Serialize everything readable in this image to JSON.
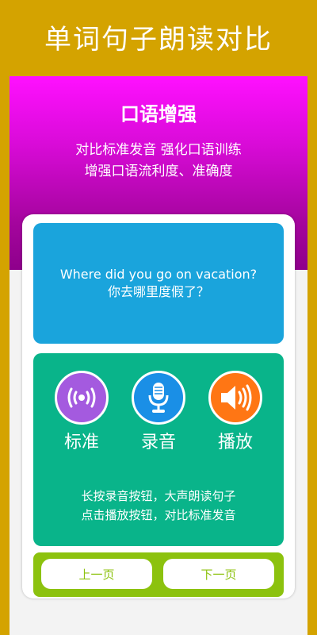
{
  "page": {
    "heading": "单词句子朗读对比"
  },
  "banner": {
    "title": "口语增强",
    "subtitle_line1": "对比标准发音 强化口语训练",
    "subtitle_line2": "增强口语流利度、准确度"
  },
  "sentence": {
    "english": "Where did you go on vacation?",
    "chinese": "你去哪里度假了？"
  },
  "controls": [
    {
      "label": "标准",
      "icon": "broadcast-icon"
    },
    {
      "label": "录音",
      "icon": "microphone-icon"
    },
    {
      "label": "播放",
      "icon": "speaker-icon"
    }
  ],
  "hint": {
    "line1": "长按录音按钮，大声朗读句子",
    "line2": "点击播放按钮，对比标准发音"
  },
  "navigation": {
    "prev_label": "上一页",
    "next_label": "下一页"
  },
  "colors": {
    "background": "#d4a300",
    "banner_top": "#ff10ff",
    "banner_bottom": "#8e008b",
    "sentence_box": "#1aa4dc",
    "control_box": "#09b48a",
    "nav_bar": "#8cc20e"
  }
}
